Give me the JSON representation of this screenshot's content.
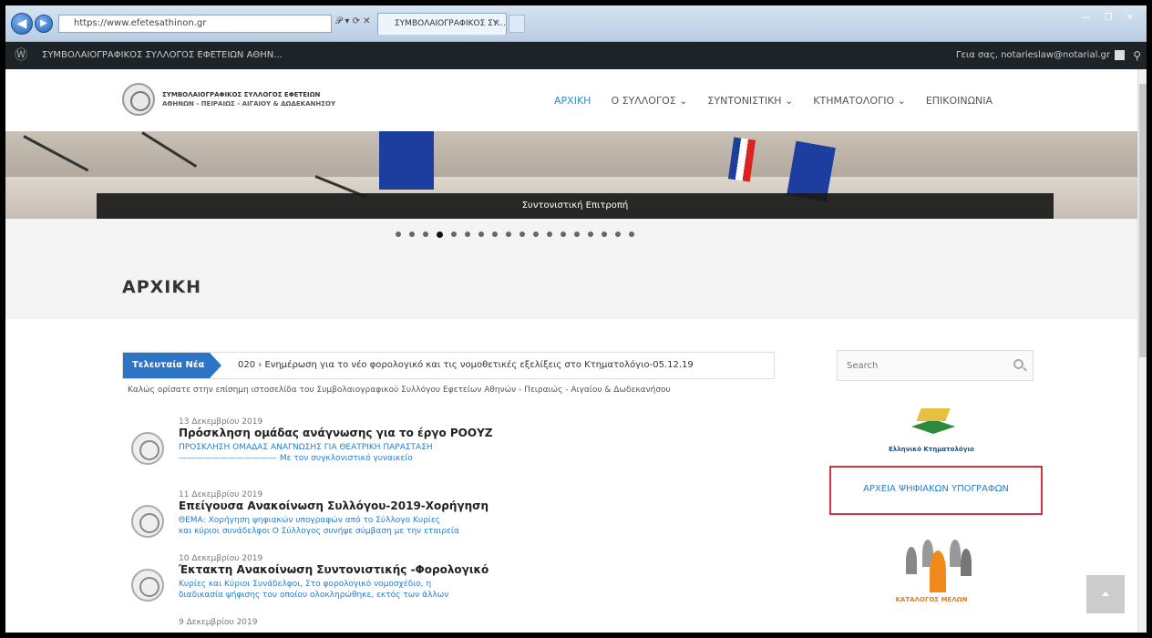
{
  "browser": {
    "address": "https://www.efetesathinon.gr",
    "address_tools": "𝒫 ▾ ⟳ ✕",
    "tab_title": "ΣΥΜΒΟΛΑΙΟΓΡΑΦΙΚΟΣ ΣΥ...",
    "tab_close": "×",
    "window_controls": "— ❐ ✕"
  },
  "admin_bar": {
    "wp_icon": "Ⓦ",
    "site": "ΣΥΜΒΟΛΑΙΟΓΡΑΦΙΚΟΣ ΣΥΛΛΟΓΟΣ ΕΦΕΤΕΙΩΝ ΑΘΗΝ...",
    "greeting": "Γεια σας, notarieslaw@notarial.gr",
    "search_icon": "⚲"
  },
  "header": {
    "logo_line1": "ΣΥΜΒΟΛΑΙΟΓΡΑΦΙΚΟΣ ΣΥΛΛΟΓΟΣ ΕΦΕΤΕΙΩΝ",
    "logo_line2": "ΑΘΗΝΩΝ - ΠΕΙΡΑΙΩΣ - ΑΙΓΑΙΟΥ & ΔΩΔΕΚΑΝΗΣΟΥ",
    "menu": [
      "ΑΡΧΙΚΗ",
      "Ο ΣΥΛΛΟΓΟΣ ⌄",
      "ΣΥΝΤΟΝΙΣΤΙΚΗ ⌄",
      "ΚΤΗΜΑΤΟΛΟΓΙΟ ⌄",
      "ΕΠΙΚΟΙΝΩΝΙΑ"
    ]
  },
  "slider": {
    "caption": "Συντονιστική Επιτροπή",
    "dot_count": 18,
    "active_dot": 3
  },
  "page": {
    "title": "ΑΡΧΙΚΗ"
  },
  "ticker": {
    "label": "Τελευταία Νέα",
    "text": "020  ›  Ενημέρωση για το νέο φορολογικό και τις νομοθετικές εξελίξεις στο Κτηματολόγιο-05.12.19"
  },
  "welcome": "Καλώς ορίσατε στην επίσημη ιστοσελίδα του Συμβολαιογραφικού Συλλόγου Εφετείων Αθηνών - Πειραιώς - Αιγαίου & Δωδεκανήσου",
  "posts": [
    {
      "date": "13 Δεκεμβρίου 2019",
      "title": "Πρόσκληση ομάδας ανάγνωσης για το έργο ΡΟΟΥΖ",
      "excerpt1": "ΠΡΟΣΚΛΗΣΗ ΟΜΑΔΑΣ ΑΝΑΓΝΩΣΗΣ ΓΙΑ ΘΕΑΤΡΙΚΗ ΠΑΡΑΣΤΑΣΗ",
      "excerpt2": "———————————— Με τον συγκλονιστικό  γυναικείο"
    },
    {
      "date": "11 Δεκεμβρίου 2019",
      "title": "Επείγουσα Ανακοίνωση Συλλόγου-2019-Χορήγηση",
      "excerpt1": "ΘΕΜΑ: Χορήγηση ψηφιακών υπογραφών από το Σύλλογο Κυρίες",
      "excerpt2": "και κύριοι συνάδελφοι Ο Σύλλογος συνήψε σύμβαση με την εταιρεία"
    },
    {
      "date": "10 Δεκεμβρίου 2019",
      "title": "Έκτακτη Ανακοίνωση Συντονιστικής -Φορολογικό",
      "excerpt1": "Κυρίες και Κύριοι Συνάδελφοι, Στο φορολογικό νομοσχέδιο, η",
      "excerpt2": "διαδικασία ψήφισης του οποίου ολοκληρώθηκε, εκτός των άλλων"
    },
    {
      "date": "9 Δεκεμβρίου 2019",
      "title": "",
      "excerpt1": "",
      "excerpt2": ""
    }
  ],
  "sidebar": {
    "search_placeholder": "Search",
    "ktimatologio_label": "Ελληνικό Κτηματολόγιο",
    "signatures_link": "ΑΡΧΕΙΑ ΨΗΦΙΑΚΩΝ ΥΠΟΓΡΑΦΩΝ",
    "members_label": "ΚΑΤΑΛΟΓΟΣ ΜΕΛΩΝ"
  },
  "colors": {
    "accent": "#2b8dd6",
    "ticker_bg": "#2b74c6",
    "highlight_border": "#d43344",
    "members_orange": "#e57e16"
  }
}
